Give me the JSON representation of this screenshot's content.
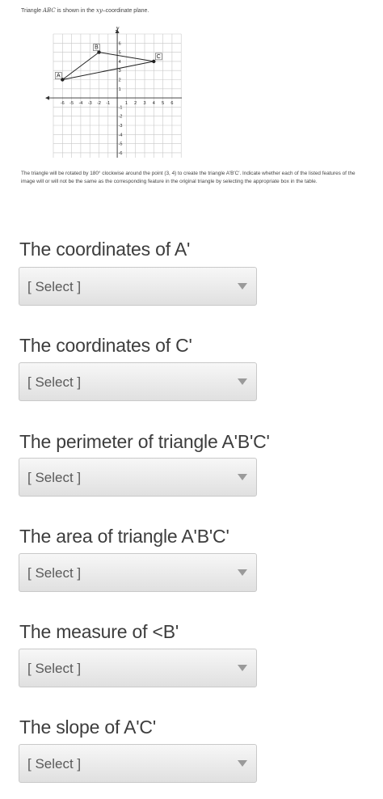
{
  "intro": {
    "prefix": "Triangle ",
    "triangle_name": "ABC",
    "middle": " is shown in the ",
    "plane_name": "xy",
    "suffix": "–coordinate plane."
  },
  "graph": {
    "x_axis_label": "x",
    "y_axis_label": "y",
    "x_ticks": [
      "-6",
      "-5",
      "-4",
      "-3",
      "-2",
      "-1",
      "1",
      "2",
      "3",
      "4",
      "5",
      "6"
    ],
    "y_ticks": [
      "6",
      "5",
      "4",
      "3",
      "2",
      "1",
      "-1",
      "-2",
      "-3",
      "-4",
      "-5",
      "-6"
    ],
    "x_tick_values": [
      -6,
      -5,
      -4,
      -3,
      -2,
      -1,
      1,
      2,
      3,
      4,
      5,
      6
    ],
    "y_tick_values": [
      6,
      5,
      4,
      3,
      2,
      1,
      -1,
      -2,
      -3,
      -4,
      -5,
      -6
    ],
    "xlim": [
      -7,
      7
    ],
    "ylim": [
      -7,
      7
    ],
    "points": [
      {
        "label": "A",
        "x": -6,
        "y": 2
      },
      {
        "label": "B",
        "x": -2,
        "y": 5
      },
      {
        "label": "C",
        "x": 4,
        "y": 4
      }
    ]
  },
  "description": "The triangle will be rotated by 180° clockwise around the point (3, 4) to create the triangle A′B′C′. Indicate whether each of the listed features of the image will or will not be the same as the corresponding feature in the original triangle by selecting the appropriate box in the table.",
  "questions": [
    {
      "label": "The coordinates of A'",
      "value": "[ Select ]"
    },
    {
      "label": "The coordinates of C'",
      "value": "[ Select ]"
    },
    {
      "label": "The perimeter of triangle A'B'C'",
      "value": "[ Select ]"
    },
    {
      "label": "The area of triangle A'B'C'",
      "value": "[ Select ]"
    },
    {
      "label": "The measure of <B'",
      "value": "[ Select ]"
    },
    {
      "label": "The slope of A'C'",
      "value": "[ Select ]"
    }
  ]
}
